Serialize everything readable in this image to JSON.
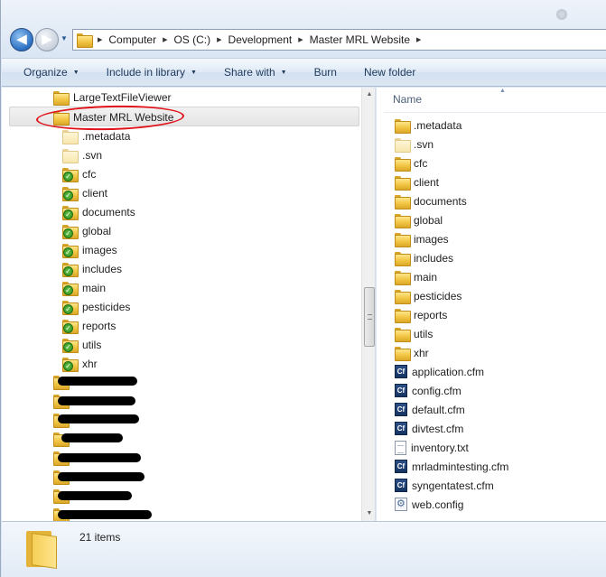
{
  "address": {
    "crumbs": [
      "Computer",
      "OS (C:)",
      "Development",
      "Master MRL Website"
    ]
  },
  "toolbar": {
    "organize": "Organize",
    "include_in_library": "Include in library",
    "share_with": "Share with",
    "burn": "Burn",
    "new_folder": "New folder"
  },
  "tree": {
    "above": "LargeTextFileViewer",
    "selected": "Master MRL Website",
    "children": [
      ".metadata",
      ".svn",
      "cfc",
      "client",
      "documents",
      "global",
      "images",
      "includes",
      "main",
      "pesticides",
      "reports",
      "utils",
      "xhr"
    ]
  },
  "list": {
    "header": "Name",
    "items": [
      {
        "name": ".metadata",
        "type": "folder"
      },
      {
        "name": ".svn",
        "type": "folder-pale"
      },
      {
        "name": "cfc",
        "type": "folder"
      },
      {
        "name": "client",
        "type": "folder"
      },
      {
        "name": "documents",
        "type": "folder"
      },
      {
        "name": "global",
        "type": "folder"
      },
      {
        "name": "images",
        "type": "folder"
      },
      {
        "name": "includes",
        "type": "folder"
      },
      {
        "name": "main",
        "type": "folder"
      },
      {
        "name": "pesticides",
        "type": "folder"
      },
      {
        "name": "reports",
        "type": "folder"
      },
      {
        "name": "utils",
        "type": "folder"
      },
      {
        "name": "xhr",
        "type": "folder"
      },
      {
        "name": "application.cfm",
        "type": "cf"
      },
      {
        "name": "config.cfm",
        "type": "cf"
      },
      {
        "name": "default.cfm",
        "type": "cf"
      },
      {
        "name": "divtest.cfm",
        "type": "cf"
      },
      {
        "name": "inventory.txt",
        "type": "txt"
      },
      {
        "name": "mrladmintesting.cfm",
        "type": "cf"
      },
      {
        "name": "syngentatest.cfm",
        "type": "cf"
      },
      {
        "name": "web.config",
        "type": "config"
      }
    ]
  },
  "status": {
    "item_count": "21 items"
  },
  "icons": {
    "cf_label": "Cf"
  }
}
